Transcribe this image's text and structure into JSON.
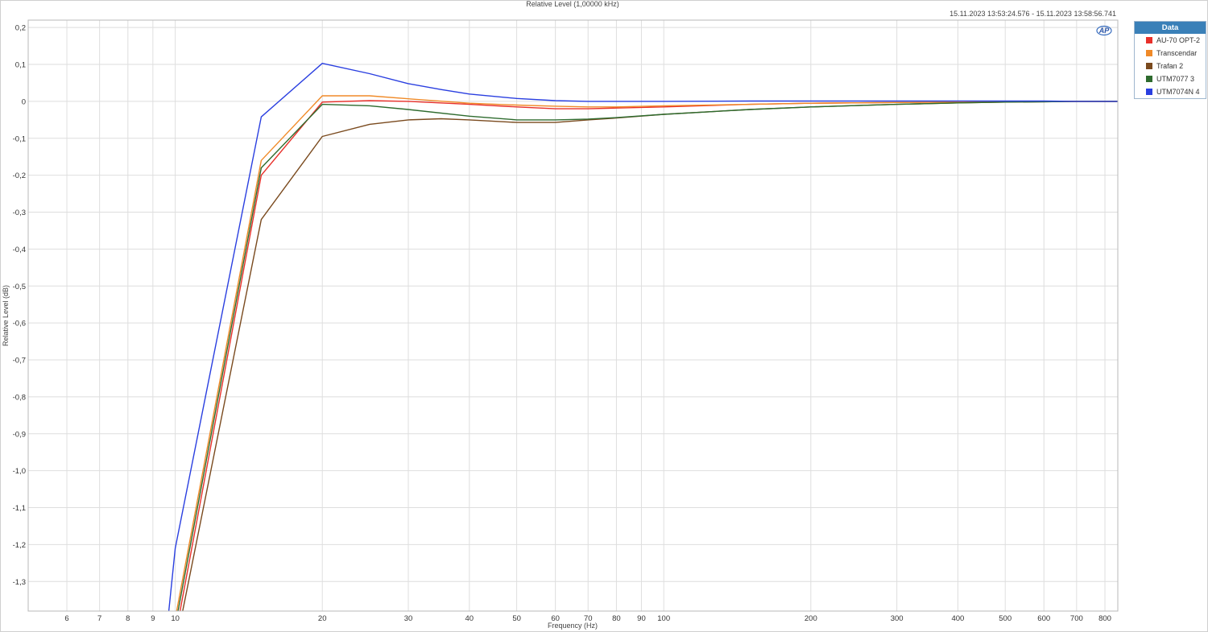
{
  "chart_data": {
    "type": "line",
    "title": "Relative Level (1,00000 kHz)",
    "timestamp": "15.11.2023 13:53:24.576 - 15.11.2023 13:58:56.741",
    "xlabel": "Frequency (Hz)",
    "ylabel": "Relative Level (dB)",
    "x_scale": "log",
    "xlim": [
      5,
      850
    ],
    "ylim": [
      -1.38,
      0.22
    ],
    "x_ticks": [
      6,
      7,
      8,
      9,
      10,
      20,
      30,
      40,
      50,
      60,
      70,
      80,
      90,
      100,
      200,
      300,
      400,
      500,
      600,
      700,
      800
    ],
    "x_tick_labels": [
      "6",
      "7",
      "8",
      "9",
      "10",
      "20",
      "30",
      "40",
      "50",
      "60",
      "70",
      "80",
      "90",
      "100",
      "200",
      "300",
      "400",
      "500",
      "600",
      "700",
      "800"
    ],
    "y_ticks": [
      0.2,
      0.1,
      0,
      -0.1,
      -0.2,
      -0.3,
      -0.4,
      -0.5,
      -0.6,
      -0.7,
      -0.8,
      -0.9,
      -1.0,
      -1.1,
      -1.2,
      -1.3
    ],
    "y_tick_labels": [
      "0,2",
      "0,1",
      "0",
      "-0,1",
      "-0,2",
      "-0,3",
      "-0,4",
      "-0,5",
      "-0,6",
      "-0,7",
      "-0,8",
      "-0,9",
      "-1,0",
      "-1,1",
      "-1,2",
      "-1,3"
    ],
    "grid": true,
    "legend_title": "Data",
    "legend_position": "right",
    "series": [
      {
        "name": "AU-70 OPT-2",
        "color": "#e8302a",
        "x": [
          10,
          15,
          20,
          25,
          30,
          40,
          50,
          60,
          70,
          80,
          100,
          150,
          200,
          300,
          400,
          500,
          600,
          700,
          800,
          850
        ],
        "y": [
          -1.45,
          -0.2,
          -0.002,
          0.002,
          0.0,
          -0.008,
          -0.015,
          -0.02,
          -0.02,
          -0.018,
          -0.015,
          -0.008,
          -0.005,
          -0.003,
          -0.002,
          -0.001,
          0.0,
          0.0,
          0.0,
          0.0
        ]
      },
      {
        "name": "Transcendar",
        "color": "#f08a28",
        "x": [
          10,
          15,
          20,
          25,
          30,
          40,
          50,
          60,
          70,
          80,
          100,
          150,
          200,
          300,
          400,
          500,
          600,
          700,
          800,
          850
        ],
        "y": [
          -1.4,
          -0.16,
          0.015,
          0.015,
          0.007,
          -0.005,
          -0.01,
          -0.013,
          -0.015,
          -0.015,
          -0.012,
          -0.008,
          -0.005,
          -0.003,
          -0.002,
          -0.001,
          0.0,
          0.0,
          0.0,
          0.0
        ]
      },
      {
        "name": "Trafan 2",
        "color": "#7a4a1e",
        "x": [
          10,
          15,
          20,
          25,
          30,
          35,
          40,
          50,
          60,
          70,
          80,
          100,
          150,
          200,
          300,
          400,
          500,
          600,
          700,
          800,
          850
        ],
        "y": [
          -1.48,
          -0.32,
          -0.095,
          -0.062,
          -0.05,
          -0.047,
          -0.05,
          -0.057,
          -0.057,
          -0.05,
          -0.045,
          -0.035,
          -0.022,
          -0.015,
          -0.008,
          -0.004,
          -0.002,
          -0.001,
          0.0,
          0.0,
          0.0
        ]
      },
      {
        "name": "UTM7077 3",
        "color": "#2e6b2e",
        "x": [
          10,
          15,
          20,
          25,
          30,
          40,
          50,
          60,
          70,
          80,
          100,
          150,
          200,
          300,
          400,
          500,
          600,
          700,
          800,
          850
        ],
        "y": [
          -1.42,
          -0.18,
          -0.008,
          -0.012,
          -0.022,
          -0.04,
          -0.05,
          -0.05,
          -0.048,
          -0.044,
          -0.035,
          -0.022,
          -0.015,
          -0.008,
          -0.004,
          -0.002,
          -0.001,
          0.0,
          0.0,
          0.0
        ]
      },
      {
        "name": "UTM7074N 4",
        "color": "#2a3fe0",
        "x": [
          9.7,
          10,
          15,
          20,
          25,
          30,
          35,
          40,
          50,
          60,
          70,
          80,
          100,
          150,
          200,
          300,
          400,
          500,
          600,
          700,
          800,
          850
        ],
        "y": [
          -1.38,
          -1.21,
          -0.042,
          0.103,
          0.075,
          0.048,
          0.032,
          0.02,
          0.008,
          0.002,
          0.0,
          0.0,
          0.0,
          0.001,
          0.001,
          0.001,
          0.001,
          0.001,
          0.001,
          0.0,
          0.0,
          0.0
        ]
      }
    ]
  }
}
